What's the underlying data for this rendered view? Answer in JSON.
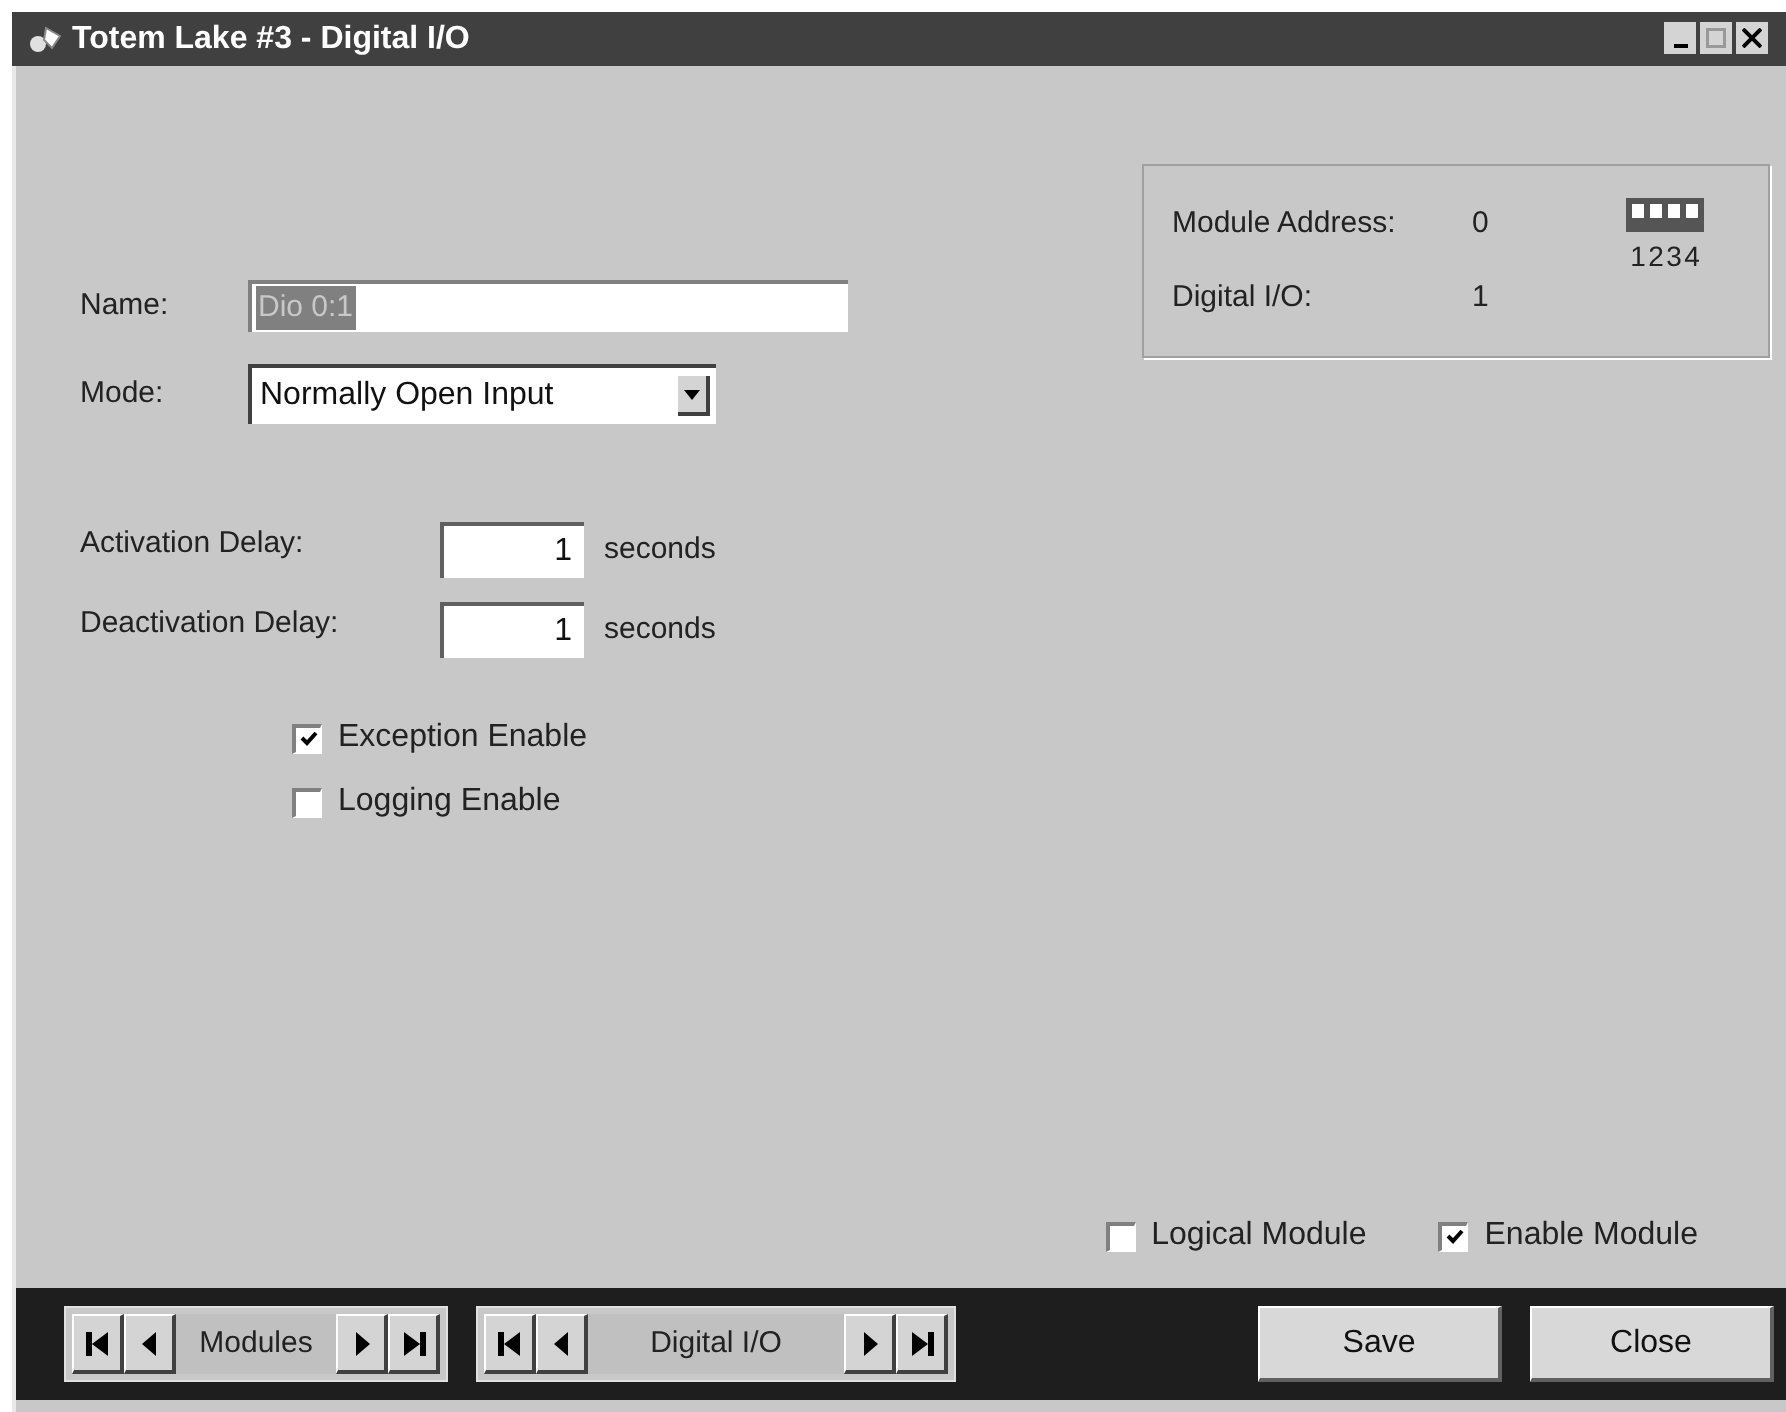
{
  "window": {
    "title": "Totem Lake #3 - Digital I/O"
  },
  "module_info": {
    "address_label": "Module Address:",
    "address_value": "0",
    "io_label": "Digital I/O:",
    "io_value": "1",
    "switches": [
      {
        "label": "1",
        "on": false
      },
      {
        "label": "2",
        "on": false
      },
      {
        "label": "3",
        "on": false
      },
      {
        "label": "4",
        "on": false
      }
    ]
  },
  "form": {
    "name_label": "Name:",
    "name_value": "Dio 0:1",
    "mode_label": "Mode:",
    "mode_value": "Normally Open Input",
    "delays": [
      {
        "label": "Activation Delay:",
        "value": "1",
        "unit": "seconds"
      },
      {
        "label": "Deactivation Delay:",
        "value": "1",
        "unit": "seconds"
      }
    ],
    "options": [
      {
        "label": "Exception Enable",
        "checked": true
      },
      {
        "label": "Logging Enable",
        "checked": false
      }
    ]
  },
  "module_options": [
    {
      "label": "Logical Module",
      "checked": false
    },
    {
      "label": "Enable Module",
      "checked": true
    }
  ],
  "navigators": [
    {
      "label": "Modules"
    },
    {
      "label": "Digital I/O"
    }
  ],
  "buttons": [
    "Save",
    "Close"
  ]
}
